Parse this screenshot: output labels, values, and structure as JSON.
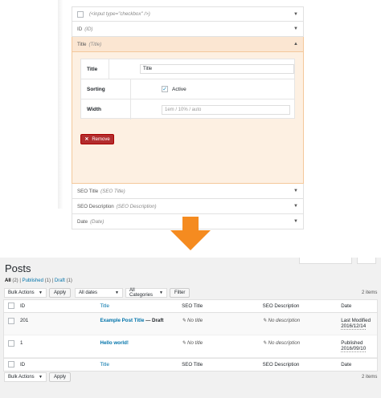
{
  "settings_panel": {
    "rows_top": [
      {
        "label": "",
        "sub": "(<input type=\"checkbox\" />)",
        "has_checkbox": true
      },
      {
        "label": "ID",
        "sub": "(ID)"
      }
    ],
    "active": {
      "label": "Title",
      "sub": "(Title)"
    },
    "form": {
      "title_label": "Title",
      "title_value": "Title",
      "sorting_label": "Sorting",
      "sorting_value": "Active",
      "width_label": "Width",
      "width_placeholder": "1em / 10% / auto"
    },
    "remove_label": "Remove",
    "rows_bottom": [
      {
        "label": "SEO Title",
        "sub": "(SEO Title)"
      },
      {
        "label": "SEO Description",
        "sub": "(SEO Description)"
      },
      {
        "label": "Date",
        "sub": "(Date)"
      }
    ]
  },
  "posts": {
    "title": "Posts",
    "filters": {
      "all": "All",
      "all_count": "(2)",
      "sep1": "|",
      "published": "Published",
      "published_count": "(1)",
      "sep2": "|",
      "draft": "Draft",
      "draft_count": "(1)"
    },
    "bulk_actions": "Bulk Actions",
    "apply": "Apply",
    "all_dates": "All dates",
    "all_categories": "All Categories",
    "filter": "Filter",
    "items": "2 items",
    "columns": {
      "id": "ID",
      "title": "Title",
      "seo_title": "SEO Title",
      "seo_description": "SEO Description",
      "date": "Date"
    },
    "rows": [
      {
        "id": "201",
        "title": "Example Post Title",
        "state": "— Draft",
        "seo_title": "No title",
        "seo_description": "No description",
        "date_status": "Last Modified",
        "date": "2016/12/14"
      },
      {
        "id": "1",
        "title": "Hello world!",
        "state": "",
        "seo_title": "No title",
        "seo_description": "No description",
        "date_status": "Published",
        "date": "2016/09/10"
      }
    ]
  }
}
